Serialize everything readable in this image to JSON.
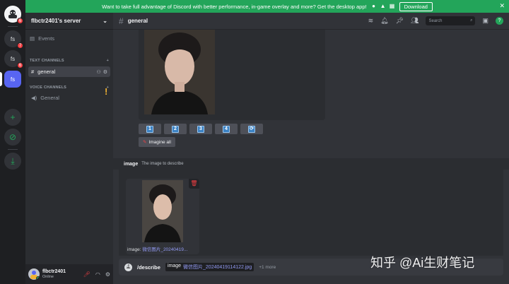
{
  "banner": {
    "text": "Want to take full advantage of Discord with better performance, in-game overlay and more? Get the desktop app!",
    "download_label": "Download",
    "close_glyph": "✕"
  },
  "rail": {
    "servers": [
      {
        "label": "",
        "badge": "6",
        "icon": "discord-logo-icon"
      },
      {
        "label": "fs",
        "badge": "7"
      },
      {
        "label": "fs",
        "badge": "6"
      },
      {
        "label": "fs",
        "badge": "",
        "active": true
      }
    ],
    "add_label": "+",
    "explore_label": "⊘",
    "download_label": "⤓"
  },
  "sidebar": {
    "server_name": "flbctr2401's server",
    "events_label": "Events",
    "text_category": "TEXT CHANNELS",
    "voice_category": "VOICE CHANNELS",
    "text_channels": [
      {
        "name": "general"
      }
    ],
    "voice_channels": [
      {
        "name": "General"
      }
    ],
    "warning_glyph": "!"
  },
  "user": {
    "name": "flbctr2401",
    "status": "Online"
  },
  "header": {
    "channel": "general",
    "search_placeholder": "Search"
  },
  "messages": {
    "upscale_buttons": [
      "1",
      "2",
      "3",
      "4"
    ],
    "reroll_glyph": "⟳",
    "imagine_all_label": "Imagine all"
  },
  "option": {
    "name": "image",
    "description": "The image to describe",
    "attachment_prefix": "image:",
    "attachment_file": "微信图片_20240419..."
  },
  "composer": {
    "command": "/describe",
    "param_name": "image",
    "param_value": "微信图片_20240419114122.jpg",
    "more": "+1 more"
  },
  "watermark": "知乎 @Ai生财笔记",
  "colors": {
    "banner": "#23a55a",
    "accent": "#5865f2",
    "danger": "#f23f43",
    "link": "#949cf7"
  }
}
